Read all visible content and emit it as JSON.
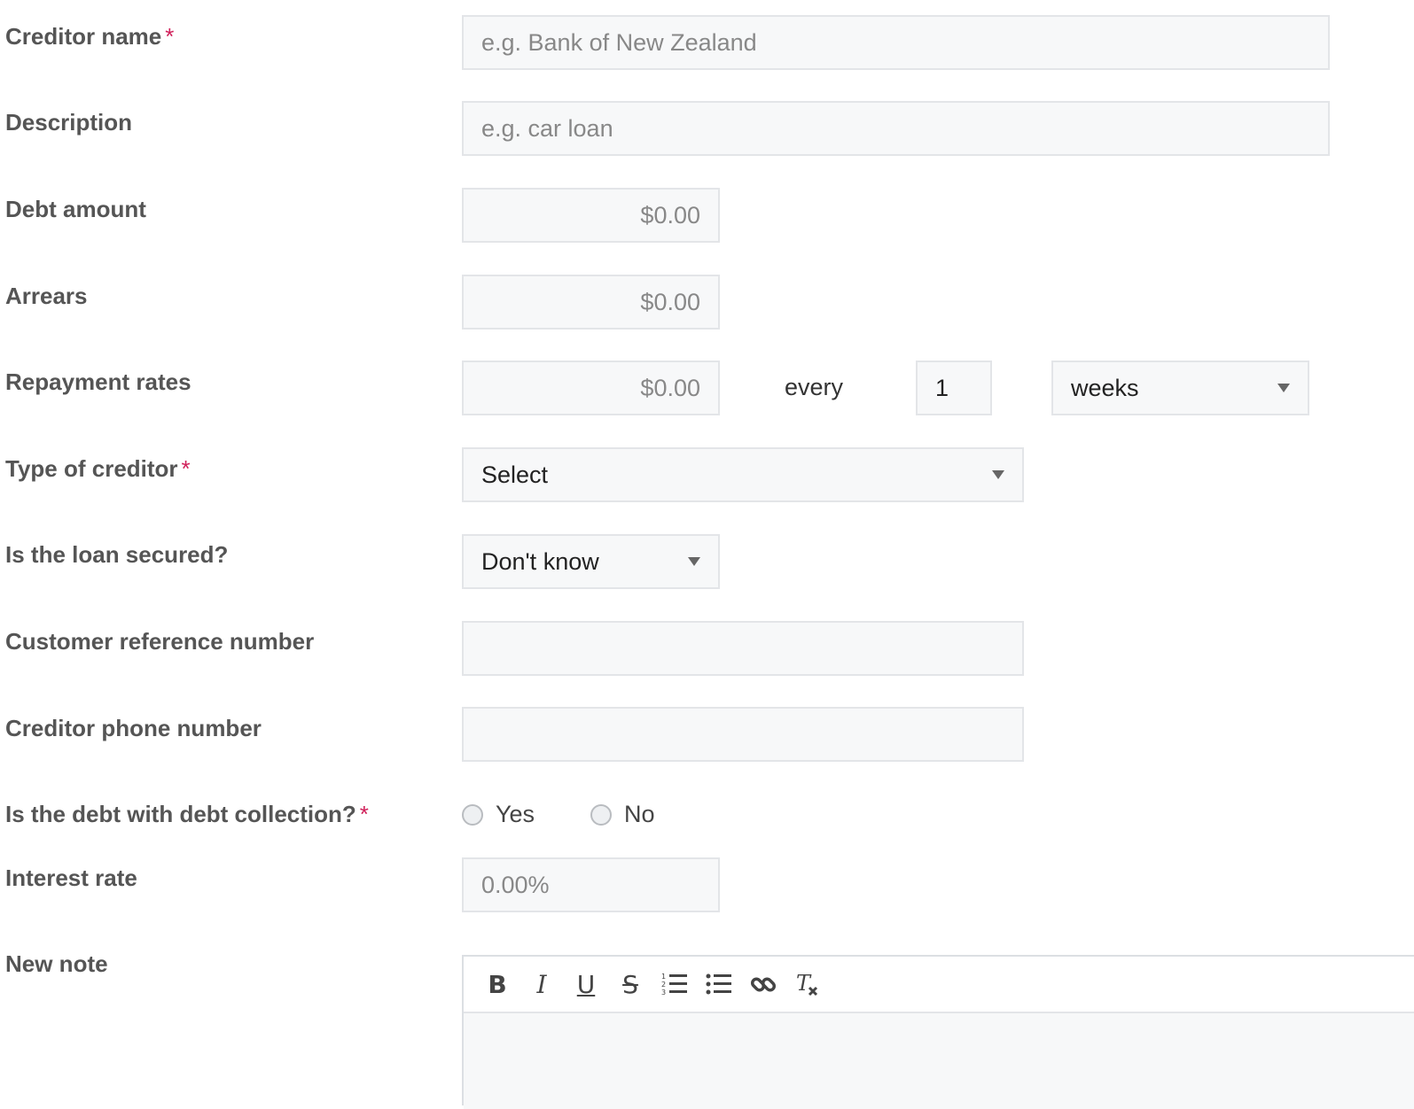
{
  "labels": {
    "creditor_name": "Creditor name",
    "description": "Description",
    "debt_amount": "Debt amount",
    "arrears": "Arrears",
    "repayment_rates": "Repayment rates",
    "type_of_creditor": "Type of creditor",
    "loan_secured": "Is the loan secured?",
    "customer_reference": "Customer reference number",
    "creditor_phone": "Creditor phone number",
    "debt_collection": "Is the debt with debt collection?",
    "interest_rate": "Interest rate",
    "new_note": "New note"
  },
  "required_marker": "*",
  "fields": {
    "creditor_name_placeholder": "e.g. Bank of New Zealand",
    "description_placeholder": "e.g. car loan",
    "debt_amount_placeholder": "$0.00",
    "arrears_placeholder": "$0.00",
    "repayment_amount_placeholder": "$0.00",
    "repayment_every_text": "every",
    "repayment_interval_value": "1",
    "repayment_period_value": "weeks",
    "type_of_creditor_value": "Select",
    "loan_secured_value": "Don't know",
    "customer_reference_value": "",
    "creditor_phone_value": "",
    "interest_rate_placeholder": "0.00%"
  },
  "radio": {
    "yes": "Yes",
    "no": "No"
  },
  "toolbar": {
    "bold": "B",
    "italic": "I",
    "underline": "U",
    "strike": "S",
    "clear": "Tx"
  },
  "icons": [
    "bold-icon",
    "italic-icon",
    "underline-icon",
    "strikethrough-icon",
    "ordered-list-icon",
    "bullet-list-icon",
    "link-icon",
    "clear-format-icon",
    "chevron-down-icon"
  ],
  "colors": {
    "required": "#d0205a",
    "field_bg": "#f7f8f9",
    "field_border": "#e3e5e8",
    "label": "#555555"
  }
}
